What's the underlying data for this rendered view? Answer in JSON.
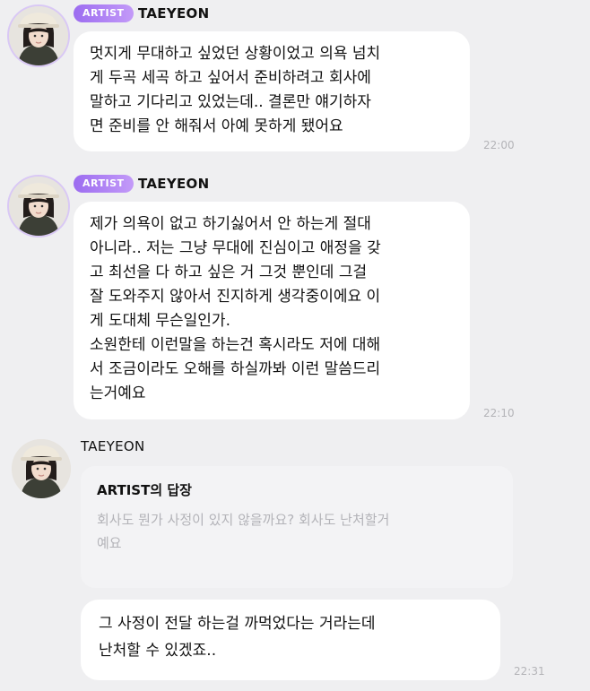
{
  "messages": [
    {
      "badge": "ARTIST",
      "name": "TAEYEON",
      "text": "멋지게 무대하고 싶었던 상황이었고 의욕 넘치\n게 두곡 세곡 하고 싶어서 준비하려고 회사에\n말하고 기다리고 있었는데.. 결론만 얘기하자\n면 준비를 안 해줘서 아예 못하게 됐어요",
      "time": "22:00"
    },
    {
      "badge": "ARTIST",
      "name": "TAEYEON",
      "text": "제가 의욕이 없고 하기싫어서 안 하는게 절대\n아니라.. 저는 그냥 무대에 진심이고 애정을 갖\n고 최선을 다 하고 싶은 거 그것 뿐인데 그걸\n잘 도와주지 않아서 진지하게 생각중이에요 이\n게 도대체 무슨일인가.\n소원한테 이런말을 하는건 혹시라도 저에 대해\n서 조금이라도 오해를 하실까봐 이런 말씀드리\n는거예요",
      "time": "22:10"
    },
    {
      "name": "TAEYEON",
      "reply_title": "ARTIST의 답장",
      "reply_quote": "회사도 뭔가 사정이 있지 않을까요? 회사도 난처할거\n예요",
      "text": "그 사정이 전달 하는걸 까먹었다는 거라는데\n난처할 수 있겠죠..",
      "time": "22:31"
    }
  ],
  "colors": {
    "background": "#efeff1",
    "badge": "#a779f3",
    "bubble": "#ffffff",
    "time": "#b4b4b8"
  },
  "icons": {
    "avatar": "profile-avatar"
  }
}
